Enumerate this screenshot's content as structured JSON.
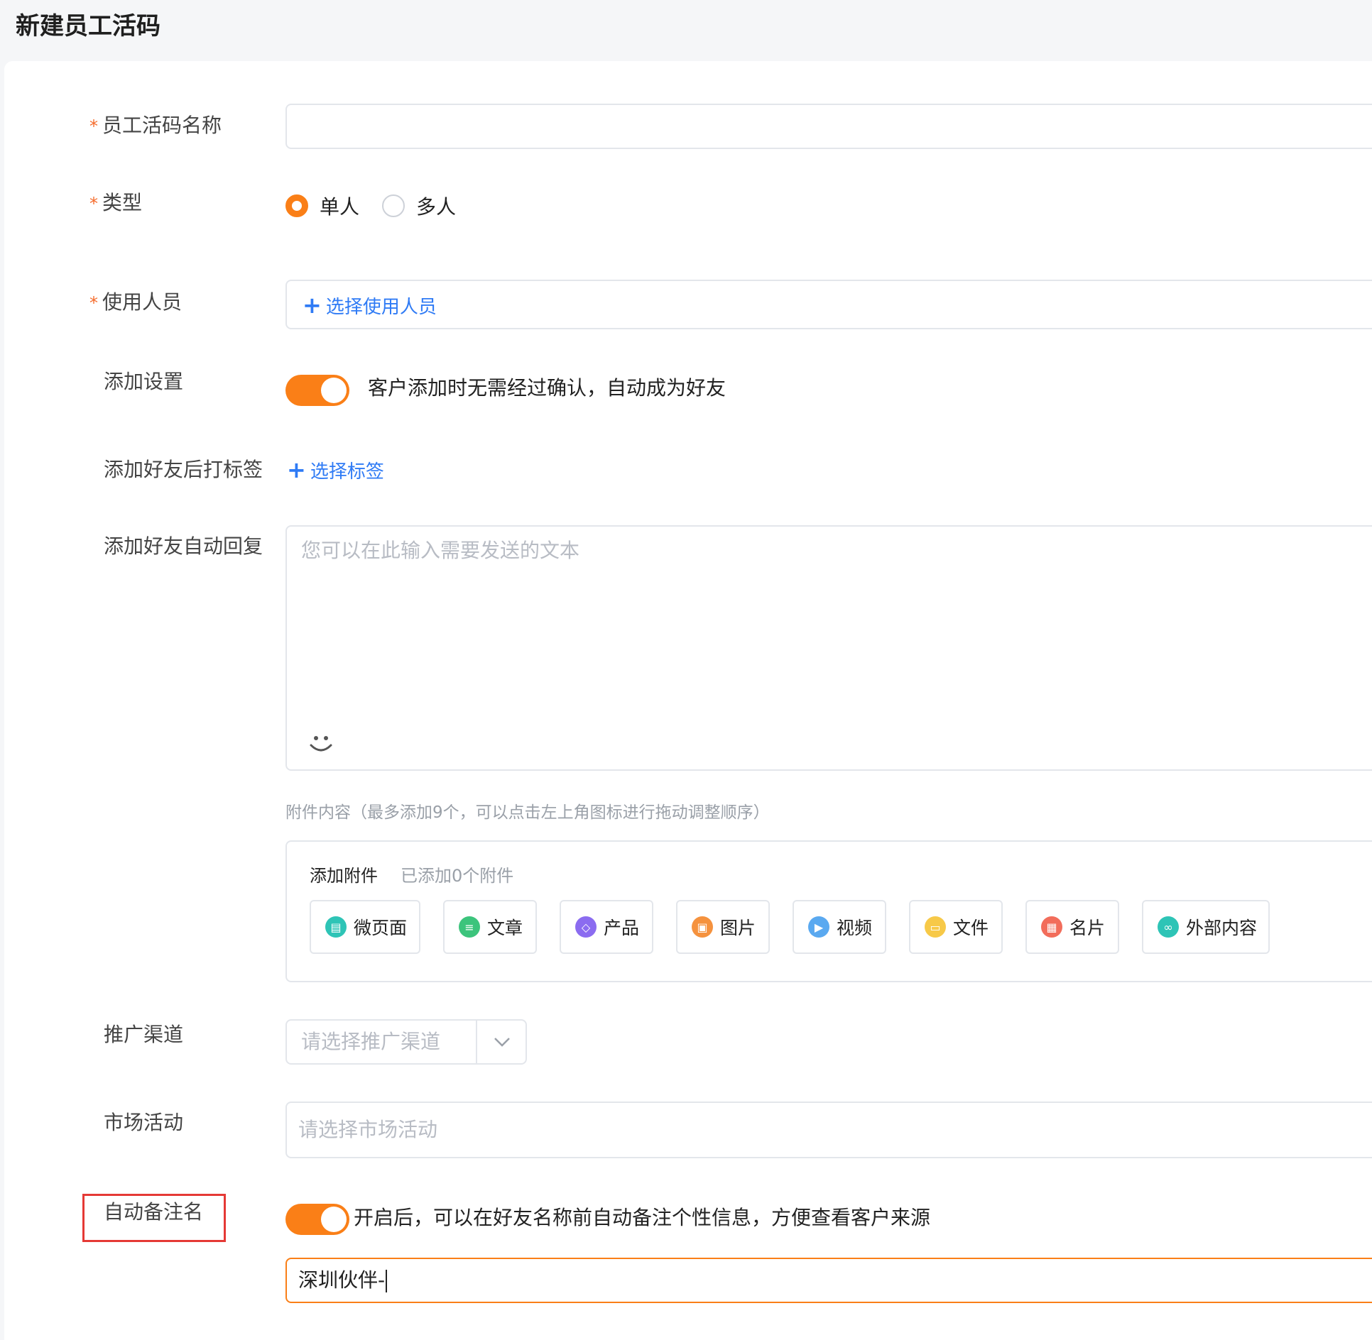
{
  "header": {
    "title": "新建员工活码"
  },
  "form": {
    "name": {
      "label": "员工活码名称",
      "value": ""
    },
    "type": {
      "label": "类型",
      "options": [
        "单人",
        "多人"
      ],
      "selected": "单人"
    },
    "users": {
      "label": "使用人员",
      "action": "选择使用人员"
    },
    "add_setting": {
      "label": "添加设置",
      "switch_on": true,
      "description": "客户添加时无需经过确认，自动成为好友"
    },
    "tags": {
      "label": "添加好友后打标签",
      "action": "选择标签"
    },
    "auto_reply": {
      "label": "添加好友自动回复",
      "placeholder": "您可以在此输入需要发送的文本"
    },
    "attachments": {
      "hint": "附件内容（最多添加9个，可以点击左上角图标进行拖动调整顺序）",
      "title": "添加附件",
      "count_text": "已添加0个附件",
      "buttons": [
        {
          "label": "微页面",
          "icon": "micro-page-icon",
          "color": "#2ec4b6"
        },
        {
          "label": "文章",
          "icon": "article-icon",
          "color": "#3cc47c"
        },
        {
          "label": "产品",
          "icon": "product-icon",
          "color": "#8b6cf0"
        },
        {
          "label": "图片",
          "icon": "image-icon",
          "color": "#f5923e"
        },
        {
          "label": "视频",
          "icon": "video-icon",
          "color": "#5aa9f0"
        },
        {
          "label": "文件",
          "icon": "file-icon",
          "color": "#f7c948"
        },
        {
          "label": "名片",
          "icon": "card-icon",
          "color": "#f26d5b"
        },
        {
          "label": "外部内容",
          "icon": "link-icon",
          "color": "#2ec4b6"
        }
      ]
    },
    "channel": {
      "label": "推广渠道",
      "placeholder": "请选择推广渠道"
    },
    "campaign": {
      "label": "市场活动",
      "placeholder": "请选择市场活动"
    },
    "auto_remark": {
      "label": "自动备注名",
      "switch_on": true,
      "description": "开启后，可以在好友名称前自动备注个性信息，方便查看客户来源",
      "value": "深圳伙伴-"
    }
  },
  "colors": {
    "accent": "#fa7f17",
    "link": "#2f7bf5",
    "required": "#f56c2d",
    "highlight": "#e53935"
  }
}
